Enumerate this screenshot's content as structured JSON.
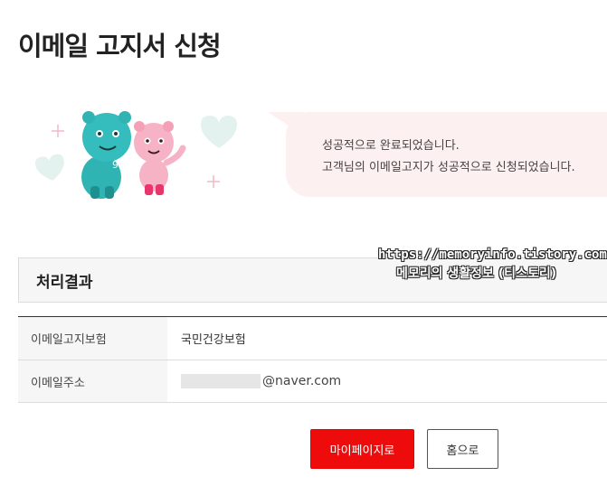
{
  "header": {
    "title": "이메일 고지서 신청"
  },
  "message": {
    "line1": "성공적으로 완료되었습니다.",
    "line2": "고객님의 이메일고지가 성공적으로 신청되었습니다."
  },
  "watermark": {
    "url": "https://memoryinfo.tistory.com",
    "blog_name": "메모리의 생활정보 (티스토리)"
  },
  "result_section": {
    "title": "처리결과"
  },
  "table": {
    "rows": [
      {
        "label": "이메일고지보험",
        "value": "국민건강보험"
      },
      {
        "label": "이메일주소",
        "value": "@naver.com"
      }
    ]
  },
  "buttons": {
    "mypage_label": "마이페이지로",
    "home_label": "홈으로"
  },
  "colors": {
    "primary": "#ee0b0b",
    "bubble_bg": "#fdf0f0",
    "mascot_blue": "#2fb3b3",
    "mascot_pink": "#f5a8bd"
  }
}
